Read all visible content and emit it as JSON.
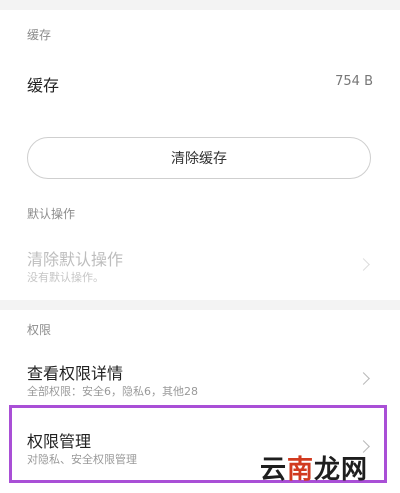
{
  "storage": {
    "section_title": "缓存",
    "cache_row": {
      "title": "缓存",
      "value": "754 B"
    },
    "clear_button_label": "清除缓存"
  },
  "defaults": {
    "section_title": "默认操作",
    "clear_defaults_row": {
      "title": "清除默认操作",
      "subtitle": "没有默认操作。",
      "enabled": false
    }
  },
  "permissions": {
    "section_title": "权限",
    "view_details_row": {
      "title": "查看权限详情",
      "subtitle": "全部权限：安全6，隐私6，其他28"
    },
    "manage_row": {
      "title": "权限管理",
      "subtitle": "对隐私、安全权限管理",
      "highlighted": true
    }
  },
  "watermark": {
    "part1": "云",
    "part2": "南",
    "part3": "龙网"
  },
  "colors": {
    "highlight": "#a94fd6",
    "watermark_accent": "#d13a1f",
    "divider_band": "#f3f3f3"
  }
}
